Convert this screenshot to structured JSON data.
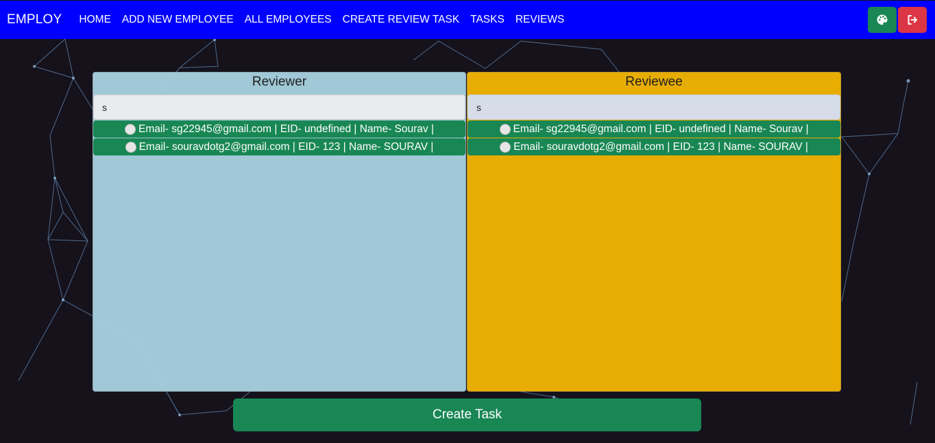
{
  "navbar": {
    "brand": "EMPLOY",
    "links": [
      "HOME",
      "ADD NEW EMPLOYEE",
      "ALL EMPLOYEES",
      "CREATE REVIEW TASK",
      "TASKS",
      "REVIEWS"
    ],
    "theme_icon": "palette-icon",
    "logout_icon": "sign-out-icon"
  },
  "reviewer": {
    "title": "Reviewer",
    "search_value": "s",
    "items": [
      "Email- sg22945@gmail.com | EID- undefined | Name- Sourav |",
      "Email- souravdotg2@gmail.com | EID- 123 | Name- SOURAV |"
    ]
  },
  "reviewee": {
    "title": "Reviewee",
    "search_value": "s",
    "items": [
      "Email- sg22945@gmail.com | EID- undefined | Name- Sourav |",
      "Email- souravdotg2@gmail.com | EID- 123 | Name- SOURAV |"
    ]
  },
  "create_button": "Create Task",
  "colors": {
    "navbar": "#0000ff",
    "background": "#15121c",
    "reviewer_panel": "#add8e6",
    "reviewee_panel": "#ffbf00",
    "success": "#198754",
    "danger": "#dc3545"
  }
}
